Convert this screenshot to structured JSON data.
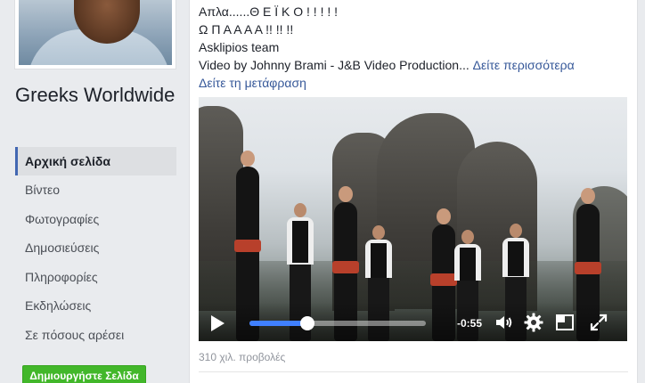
{
  "sidebar": {
    "page_name": "Greeks Worldwide",
    "nav": [
      {
        "label": "Αρχική σελίδα",
        "active": true
      },
      {
        "label": "Βίντεο"
      },
      {
        "label": "Φωτογραφίες"
      },
      {
        "label": "Δημοσιεύσεις"
      },
      {
        "label": "Πληροφορίες"
      },
      {
        "label": "Εκδηλώσεις"
      },
      {
        "label": "Σε πόσους αρέσει"
      }
    ],
    "create_page_label": "Δημιουργήστε Σελίδα"
  },
  "post": {
    "lines": [
      "Απλα......Θ Ε Ϊ Κ Ο ! ! ! ! !",
      "Ω Π Α Α Α Α !! !! !!",
      "Asklipios team",
      "Video by Johnny Brami - J&B Video Production..."
    ],
    "see_more": "Δείτε περισσότερα",
    "see_translation": "Δείτε τη μετάφραση",
    "video": {
      "time_remaining": "-0:55",
      "progress": 0.33,
      "icons": [
        "play-icon",
        "volume-icon",
        "gear-icon",
        "pip-icon",
        "fullscreen-icon"
      ]
    },
    "views": "310 χιλ. προβολές"
  },
  "colors": {
    "link": "#365899",
    "progress": "#4080ff",
    "create_button": "#42b72a",
    "background": "#e9ebee"
  }
}
